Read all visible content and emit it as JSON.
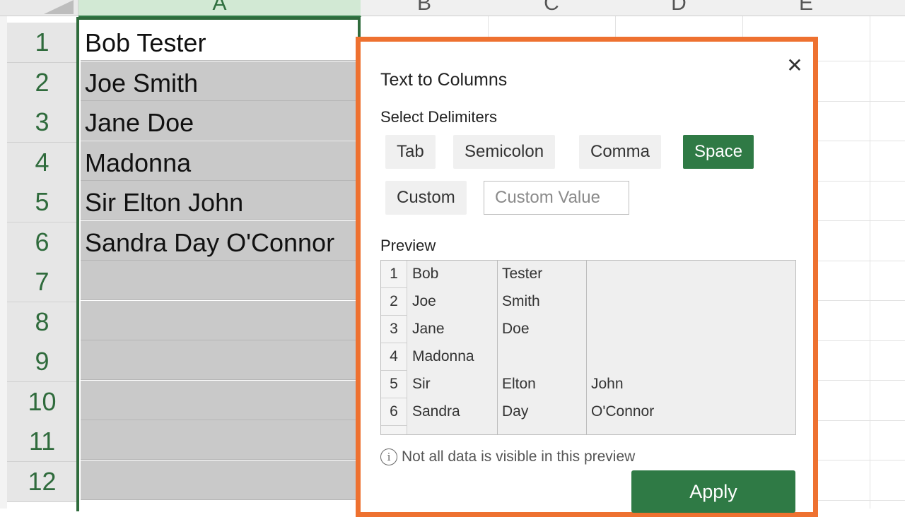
{
  "columns": [
    "A",
    "B",
    "C",
    "D",
    "E"
  ],
  "rows": [
    "1",
    "2",
    "3",
    "4",
    "5",
    "6",
    "7",
    "8",
    "9",
    "10",
    "11",
    "12"
  ],
  "cells_A": [
    "Bob Tester",
    "Joe Smith",
    "Jane Doe",
    "Madonna",
    "Sir Elton John",
    "Sandra Day O'Connor"
  ],
  "dialog": {
    "title": "Text to Columns",
    "select_label": "Select Delimiters",
    "delimiters": [
      "Tab",
      "Semicolon",
      "Comma",
      "Space"
    ],
    "selected_delimiter": "Space",
    "custom_label": "Custom",
    "custom_placeholder": "Custom Value",
    "custom_value": "",
    "preview_label": "Preview",
    "preview_rows": [
      [
        "1",
        "Bob",
        "Tester",
        ""
      ],
      [
        "2",
        "Joe",
        "Smith",
        ""
      ],
      [
        "3",
        "Jane",
        "Doe",
        ""
      ],
      [
        "4",
        "Madonna",
        "",
        ""
      ],
      [
        "5",
        "Sir",
        "Elton",
        "John"
      ],
      [
        "6",
        "Sandra",
        "Day",
        "O'Connor"
      ]
    ],
    "info_text": "Not all data is visible in this preview",
    "info_icon": "info-icon",
    "close_icon": "close-icon",
    "apply_label": "Apply"
  },
  "colors": {
    "accent_green": "#2f7a45",
    "dialog_border": "#ee7130",
    "selection_fill": "#c9c9c9"
  }
}
